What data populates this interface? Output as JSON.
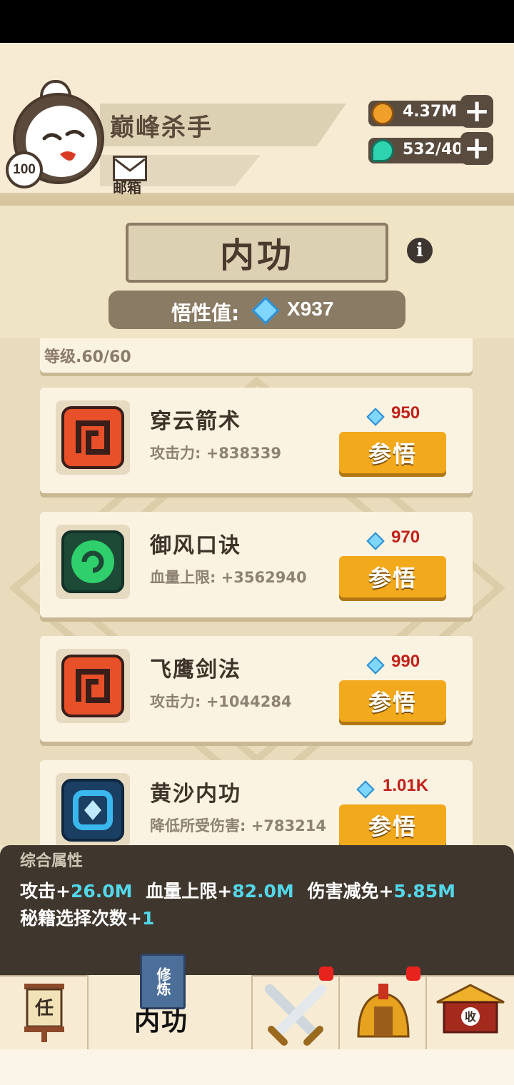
{
  "player": {
    "name": "巅峰杀手",
    "level": "100",
    "mail_label": "邮箱"
  },
  "resources": {
    "coins": "4.37M",
    "energy": "532/40"
  },
  "page": {
    "title": "内功",
    "insight_label": "悟性值:",
    "insight_value": "X937",
    "gem_glyph": "悟"
  },
  "partial_item": {
    "level_text": "等级.60/60"
  },
  "skills": [
    {
      "name": "穿云箭术",
      "stat": "攻击力: +838339",
      "cost": "950",
      "button": "参悟",
      "icon": "red-scroll-icon",
      "color": "#e8502a"
    },
    {
      "name": "御风口诀",
      "stat": "血量上限: +3562940",
      "cost": "970",
      "button": "参悟",
      "icon": "green-swirl-icon",
      "color": "#2fcf6b"
    },
    {
      "name": "飞鹰剑法",
      "stat": "攻击力: +1044284",
      "cost": "990",
      "button": "参悟",
      "icon": "red-scroll-icon",
      "color": "#e8502a"
    },
    {
      "name": "黄沙内功",
      "stat": "降低所受伤害: +783214",
      "cost": "1.01K",
      "button": "参悟",
      "icon": "blue-crystal-icon",
      "color": "#3ab8ee"
    }
  ],
  "summary": {
    "title": "综合属性",
    "attack_label": "攻击+",
    "attack_value": "26.0M",
    "hp_label": "血量上限+",
    "hp_value": "82.0M",
    "dmg_label": "伤害减免+",
    "dmg_value": "5.85M",
    "choice_label": "秘籍选择次数+",
    "choice_value": "1"
  },
  "nav": {
    "task_glyph": "任",
    "active_label": "内功",
    "book_text": "修炼",
    "collect_glyph": "收"
  },
  "colors": {
    "accent_button": "#f2a91c",
    "cost_red": "#c0211c",
    "summary_value": "#53d7e8"
  }
}
